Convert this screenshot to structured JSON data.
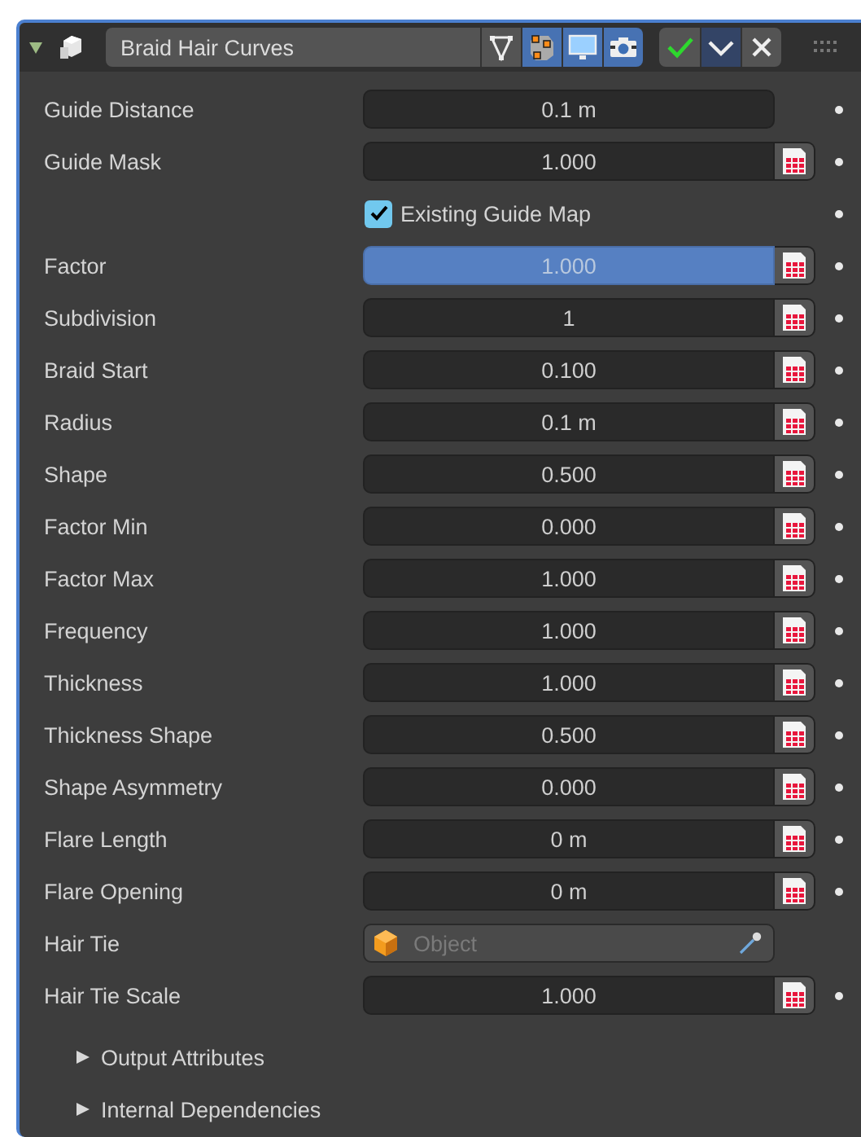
{
  "header": {
    "expanded": true,
    "name": "Braid Hair Curves",
    "toggles": [
      {
        "kind": "vertex",
        "on": false
      },
      {
        "kind": "editmode",
        "on": true
      },
      {
        "kind": "viewport",
        "on": true
      },
      {
        "kind": "render",
        "on": true
      }
    ],
    "actions": [
      {
        "kind": "apply"
      },
      {
        "kind": "menu"
      },
      {
        "kind": "close"
      }
    ]
  },
  "rows": [
    {
      "kind": "number",
      "label": "Guide Distance",
      "value": "0.1 m",
      "attribute": false,
      "highlighted": false,
      "dot": true
    },
    {
      "kind": "number",
      "label": "Guide Mask",
      "value": "1.000",
      "attribute": true,
      "highlighted": false,
      "dot": true
    },
    {
      "kind": "checkbox",
      "label": "Existing Guide Map",
      "checked": true,
      "dot": true
    },
    {
      "kind": "number",
      "label": "Factor",
      "value": "1.000",
      "attribute": true,
      "highlighted": true,
      "dot": true
    },
    {
      "kind": "number",
      "label": "Subdivision",
      "value": "1",
      "attribute": true,
      "highlighted": false,
      "dot": true
    },
    {
      "kind": "number",
      "label": "Braid Start",
      "value": "0.100",
      "attribute": true,
      "highlighted": false,
      "dot": true
    },
    {
      "kind": "number",
      "label": "Radius",
      "value": "0.1 m",
      "attribute": true,
      "highlighted": false,
      "dot": true
    },
    {
      "kind": "number",
      "label": "Shape",
      "value": "0.500",
      "attribute": true,
      "highlighted": false,
      "dot": true
    },
    {
      "kind": "number",
      "label": "Factor Min",
      "value": "0.000",
      "attribute": true,
      "highlighted": false,
      "dot": true
    },
    {
      "kind": "number",
      "label": "Factor Max",
      "value": "1.000",
      "attribute": true,
      "highlighted": false,
      "dot": true
    },
    {
      "kind": "number",
      "label": "Frequency",
      "value": "1.000",
      "attribute": true,
      "highlighted": false,
      "dot": true
    },
    {
      "kind": "number",
      "label": "Thickness",
      "value": "1.000",
      "attribute": true,
      "highlighted": false,
      "dot": true
    },
    {
      "kind": "number",
      "label": "Thickness Shape",
      "value": "0.500",
      "attribute": true,
      "highlighted": false,
      "dot": true
    },
    {
      "kind": "number",
      "label": "Shape Asymmetry",
      "value": "0.000",
      "attribute": true,
      "highlighted": false,
      "dot": true
    },
    {
      "kind": "number",
      "label": "Flare Length",
      "value": "0 m",
      "attribute": true,
      "highlighted": false,
      "dot": true
    },
    {
      "kind": "number",
      "label": "Flare Opening",
      "value": "0 m",
      "attribute": true,
      "highlighted": false,
      "dot": true
    },
    {
      "kind": "object",
      "label": "Hair Tie",
      "placeholder": "Object",
      "dot": false
    },
    {
      "kind": "number",
      "label": "Hair Tie Scale",
      "value": "1.000",
      "attribute": true,
      "highlighted": false,
      "dot": true
    }
  ],
  "subpanels": [
    {
      "label": "Output Attributes",
      "expanded": false
    },
    {
      "label": "Internal Dependencies",
      "expanded": false
    }
  ]
}
